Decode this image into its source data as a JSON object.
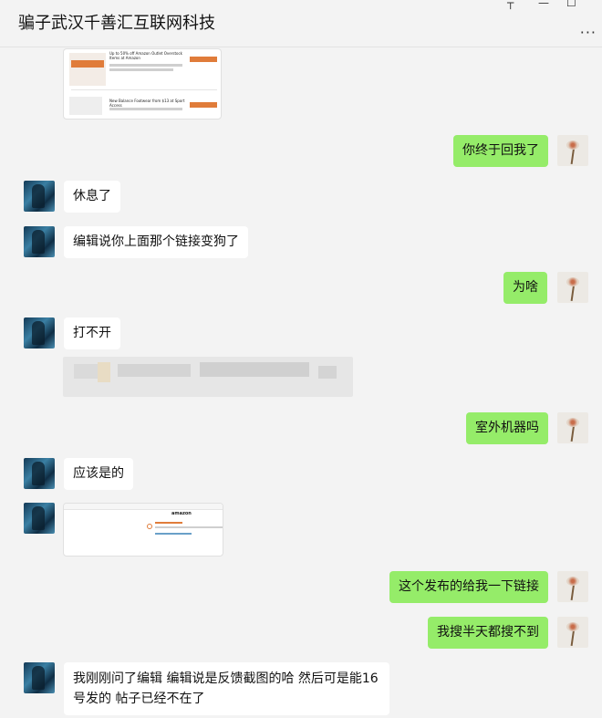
{
  "header": {
    "title": "骗子武汉千善汇互联网科技",
    "minimize_icon": "minimize-icon",
    "maximize_icon": "maximize-icon",
    "more_icon": "more-icon"
  },
  "messages": [
    {
      "side": "right",
      "text": "你终于回我了"
    },
    {
      "side": "left",
      "text": "休息了"
    },
    {
      "side": "left",
      "text": "编辑说你上面那个链接变狗了"
    },
    {
      "side": "right",
      "text": "为啥"
    },
    {
      "side": "left",
      "text": "打不开"
    },
    {
      "side": "right",
      "text": "室外机器吗"
    },
    {
      "side": "left",
      "text": "应该是的"
    },
    {
      "side": "right",
      "text": "这个发布的给我一下链接"
    },
    {
      "side": "right",
      "text": "我搜半天都搜不到"
    },
    {
      "side": "left",
      "text": "我刚刚问了编辑 编辑说是反馈截图的哈  然后可是能16号发的 帖子已经不在了"
    }
  ],
  "screenshot_card": {
    "deal1_title": "Up to 50% off Amazon Outlet Overstock Items at Amazon",
    "deal1_tag": "Amazon Outlet",
    "deal2_title": "New Balance Footwear from $13 at Sport Access",
    "button_label": "GO TO STORE"
  },
  "amazon_card": {
    "logo": "amazon"
  }
}
